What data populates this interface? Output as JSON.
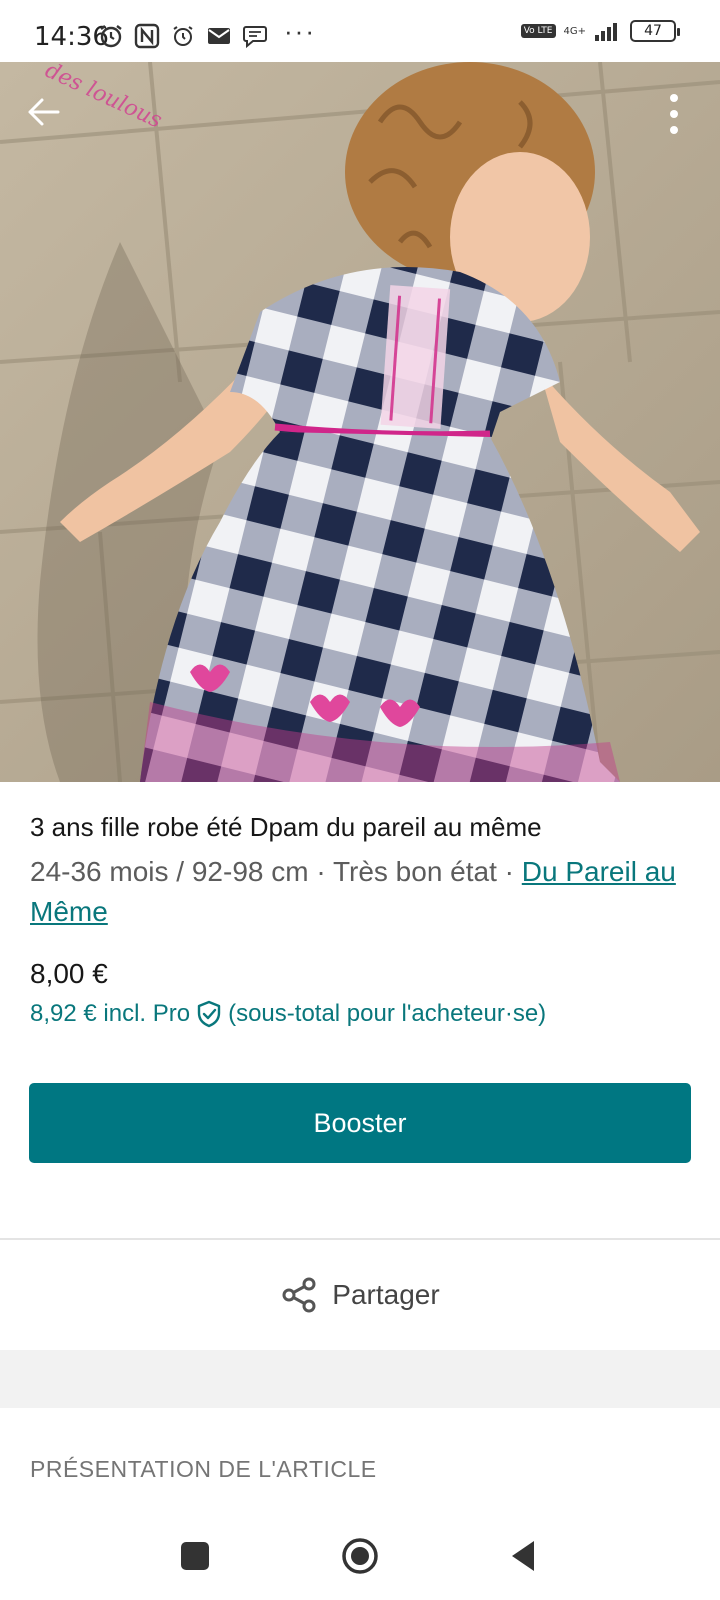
{
  "status_bar": {
    "time": "14:36",
    "icons": [
      "alarm-icon",
      "nfc-icon",
      "alarm-icon",
      "mail-icon",
      "chat-icon"
    ],
    "more": "···",
    "volte": "Vo LTE",
    "network": "4G+",
    "battery": "47"
  },
  "hero": {
    "watermark": "des loulous",
    "back_icon": "arrow-left-icon",
    "more_icon": "more-vertical-icon"
  },
  "item": {
    "title": "3 ans fille robe été Dpam du pareil au même",
    "details": "24-36 mois / 92-98 cm · Très bon état · ",
    "brand": "Du Pareil au Même",
    "price": "8,00 €",
    "pro_price": "8,92 € incl. Pro",
    "pro_note": "(sous-total pour l'acheteur·se)"
  },
  "actions": {
    "booster": "Booster",
    "share": "Partager"
  },
  "section": {
    "presentation": "PRÉSENTATION DE L'ARTICLE"
  },
  "colors": {
    "accent": "#007782",
    "link": "#09777c"
  }
}
